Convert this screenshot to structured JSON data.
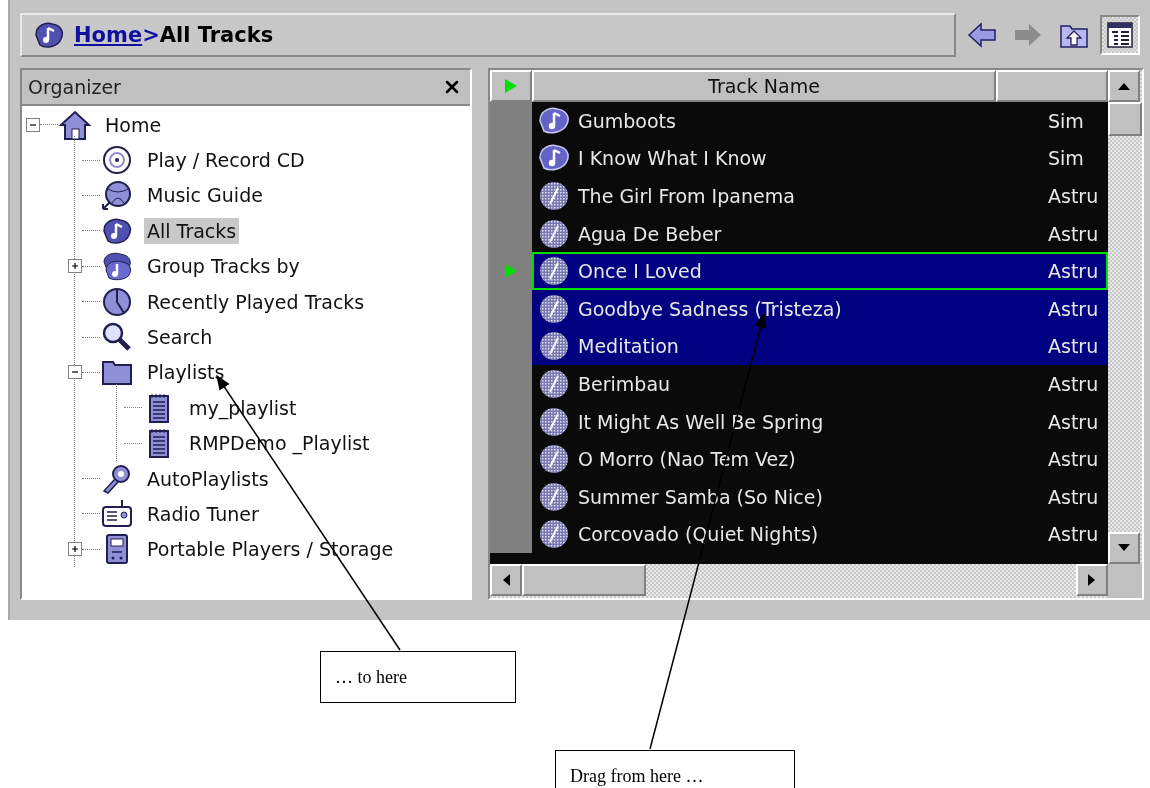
{
  "address_bar": {
    "link": "Home",
    "separator": ">",
    "current": "All Tracks"
  },
  "nav_buttons": [
    {
      "kind": "back",
      "disabled": false,
      "pressed": false
    },
    {
      "kind": "forward",
      "disabled": true,
      "pressed": false
    },
    {
      "kind": "up",
      "disabled": false,
      "pressed": false
    },
    {
      "kind": "view",
      "disabled": false,
      "pressed": true
    }
  ],
  "organizer": {
    "title": "Organizer",
    "tree": [
      {
        "label": "Home",
        "kind": "home",
        "selected": false,
        "expanded": true,
        "children": [
          {
            "label": "Play / Record CD",
            "kind": "cd",
            "selected": false
          },
          {
            "label": "Music Guide",
            "kind": "globe",
            "selected": false
          },
          {
            "label": "All Tracks",
            "kind": "tracks",
            "selected": true
          },
          {
            "label": "Group Tracks by",
            "kind": "group",
            "selected": false,
            "expanded": false
          },
          {
            "label": "Recently Played Tracks",
            "kind": "recent",
            "selected": false
          },
          {
            "label": "Search",
            "kind": "search",
            "selected": false
          },
          {
            "label": "Playlists",
            "kind": "folder",
            "selected": false,
            "expanded": true,
            "children": [
              {
                "label": "my_playlist",
                "kind": "playlist",
                "selected": false
              },
              {
                "label": "RMPDemo _Playlist",
                "kind": "playlist",
                "selected": false
              }
            ]
          },
          {
            "label": "AutoPlaylists",
            "kind": "auto",
            "selected": false
          },
          {
            "label": "Radio Tuner",
            "kind": "radio",
            "selected": false
          },
          {
            "label": "Portable Players / Storage",
            "kind": "portable",
            "selected": false,
            "expanded": false
          }
        ]
      }
    ]
  },
  "tracks": {
    "column_1": "Track Name",
    "rows": [
      {
        "title": "Gumboots",
        "artist": "Sim",
        "kind": "ra",
        "selected": false,
        "playing": false
      },
      {
        "title": "I Know What I Know",
        "artist": "Sim",
        "kind": "ra",
        "selected": false,
        "playing": false
      },
      {
        "title": "The Girl From Ipanema",
        "artist": "Astru",
        "kind": "mp3",
        "selected": false,
        "playing": false
      },
      {
        "title": "Agua De Beber",
        "artist": "Astru",
        "kind": "mp3",
        "selected": false,
        "playing": false
      },
      {
        "title": "Once I Loved",
        "artist": "Astru",
        "kind": "mp3",
        "selected": true,
        "playing": true
      },
      {
        "title": "Goodbye Sadness (Tristeza)",
        "artist": "Astru",
        "kind": "mp3",
        "selected": true,
        "playing": false
      },
      {
        "title": "Meditation",
        "artist": "Astru",
        "kind": "mp3",
        "selected": true,
        "playing": false
      },
      {
        "title": "Berimbau",
        "artist": "Astru",
        "kind": "mp3",
        "selected": false,
        "playing": false
      },
      {
        "title": "It Might As Well Be Spring",
        "artist": "Astru",
        "kind": "mp3",
        "selected": false,
        "playing": false
      },
      {
        "title": "O Morro (Nao Tem Vez)",
        "artist": "Astru",
        "kind": "mp3",
        "selected": false,
        "playing": false
      },
      {
        "title": "Summer Samba (So Nice)",
        "artist": "Astru",
        "kind": "mp3",
        "selected": false,
        "playing": false
      },
      {
        "title": "Corcovado (Quiet Nights)",
        "artist": "Astru",
        "kind": "mp3",
        "selected": false,
        "playing": false
      }
    ]
  },
  "annotations": [
    {
      "text": "… to here"
    },
    {
      "text": "Drag from here …"
    }
  ]
}
